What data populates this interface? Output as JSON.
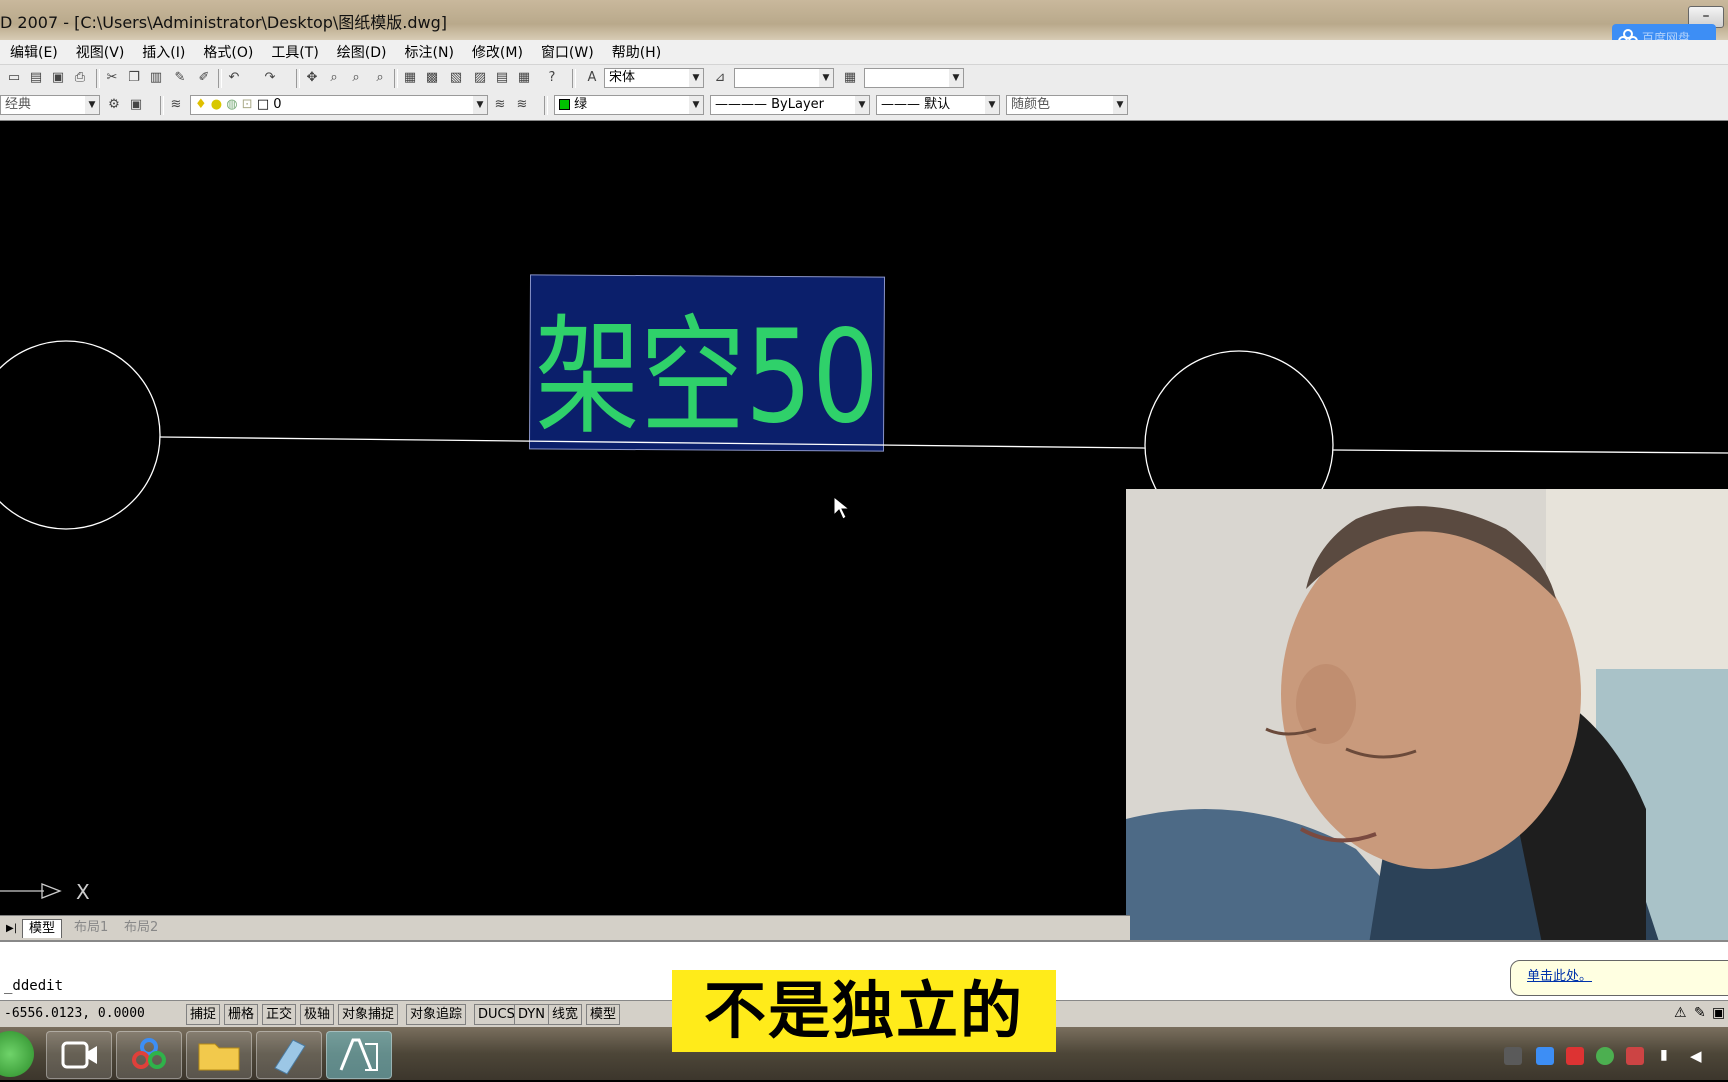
{
  "window": {
    "title": "D 2007 - [C:\\Users\\Administrator\\Desktop\\图纸模版.dwg]",
    "minimize_label": "–"
  },
  "cloud_widget": {
    "label": "百度网盘"
  },
  "menu": {
    "items": [
      "编辑(E)",
      "视图(V)",
      "插入(I)",
      "格式(O)",
      "工具(T)",
      "绘图(D)",
      "标注(N)",
      "修改(M)",
      "窗口(W)",
      "帮助(H)"
    ]
  },
  "toolbar1": {
    "text_style_value": "宋体",
    "dim_style_value": "",
    "table_style_value": ""
  },
  "toolbar2": {
    "workspace_value": "经典",
    "layer_value": "0",
    "color_value": "绿",
    "linetype_value": "ByLayer",
    "lineweight_value": "默认",
    "plotstyle_value": "随颜色"
  },
  "drawing": {
    "text_entity": "架空50",
    "text_color": "#2fd16a",
    "highlight_color": "#0b1f6b",
    "axis_label": "X"
  },
  "layout_tabs": {
    "model": "模型",
    "layout1": "布局1",
    "layout2": "布局2"
  },
  "command": {
    "text": "_ddedit"
  },
  "status": {
    "coords": "-6556.0123,  0.0000",
    "buttons": [
      "捕捉",
      "栅格",
      "正交",
      "极轴",
      "对象捕捉",
      "对象追踪",
      "DUCS",
      "DYN",
      "线宽",
      "模型"
    ]
  },
  "balloon": {
    "link": "单击此处。"
  },
  "caption": {
    "text": "不是独立的"
  },
  "colors": {
    "accent": "#3d8ef5",
    "caption_bg": "#ffeb1a"
  }
}
